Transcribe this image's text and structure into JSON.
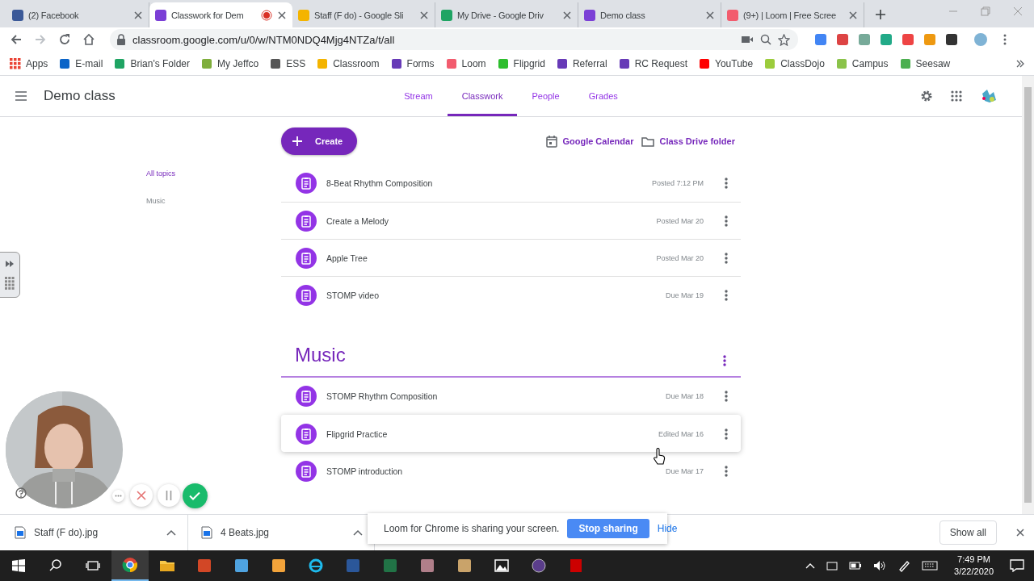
{
  "browser": {
    "tabs": [
      {
        "title": "(2) Facebook",
        "selected": false,
        "recording": false,
        "color": "#3b5998"
      },
      {
        "title": "Classwork for Dem",
        "selected": true,
        "recording": true,
        "color": "#7b3fd6"
      },
      {
        "title": "Staff (F do) - Google Sli",
        "selected": false,
        "recording": false,
        "color": "#f4b400"
      },
      {
        "title": "My Drive - Google Driv",
        "selected": false,
        "recording": false,
        "color": "#1fa463"
      },
      {
        "title": "Demo class",
        "selected": false,
        "recording": false,
        "color": "#7b3fd6"
      },
      {
        "title": "(9+) | Loom | Free Scree",
        "selected": false,
        "recording": false,
        "color": "#f25c6e"
      }
    ],
    "url": "classroom.google.com/u/0/w/NTM0NDQ4Mjg4NTZa/t/all",
    "bookmarks": [
      {
        "label": "Apps",
        "color": "#ea4335"
      },
      {
        "label": "E-mail",
        "color": "#0a64c8"
      },
      {
        "label": "Brian's Folder",
        "color": "#1fa463"
      },
      {
        "label": "My Jeffco",
        "color": "#7fae3c"
      },
      {
        "label": "ESS",
        "color": "#555555"
      },
      {
        "label": "Classroom",
        "color": "#f4b400"
      },
      {
        "label": "Forms",
        "color": "#673ab7"
      },
      {
        "label": "Loom",
        "color": "#f25c6e"
      },
      {
        "label": "Flipgrid",
        "color": "#2dbe2d"
      },
      {
        "label": "Referral",
        "color": "#673ab7"
      },
      {
        "label": "RC Request",
        "color": "#673ab7"
      },
      {
        "label": "YouTube",
        "color": "#ff0000"
      },
      {
        "label": "ClassDojo",
        "color": "#9ccc3c"
      },
      {
        "label": "Campus",
        "color": "#8bc34a"
      },
      {
        "label": "Seesaw",
        "color": "#4caf50"
      }
    ]
  },
  "classroom": {
    "title": "Demo class",
    "nav": [
      {
        "label": "Stream",
        "selected": false
      },
      {
        "label": "Classwork",
        "selected": true
      },
      {
        "label": "People",
        "selected": false
      },
      {
        "label": "Grades",
        "selected": false
      }
    ],
    "create": "Create",
    "links": [
      "Google Calendar",
      "Class Drive folder"
    ],
    "topics": [
      {
        "label": "All topics",
        "selected": true
      },
      {
        "label": "Music",
        "selected": false
      }
    ],
    "items": [
      {
        "title": "8-Beat Rhythm Composition",
        "meta": "Posted 7:12 PM",
        "hovered": false
      },
      {
        "title": "Create a Melody",
        "meta": "Posted Mar 20",
        "hovered": false
      },
      {
        "title": "Apple Tree",
        "meta": "Posted Mar 20",
        "hovered": false
      },
      {
        "title": "STOMP video",
        "meta": "Due Mar 19",
        "hovered": false
      }
    ],
    "sections": [
      {
        "title": "Music",
        "items": [
          {
            "title": "STOMP Rhythm Composition",
            "meta": "Due Mar 18",
            "hovered": false
          },
          {
            "title": "Flipgrid Practice",
            "meta": "Edited Mar 16",
            "hovered": true
          },
          {
            "title": "STOMP introduction",
            "meta": "Due Mar 17",
            "hovered": false
          }
        ]
      }
    ]
  },
  "downloads": {
    "files": [
      "Staff (F do).jpg",
      "4 Beats.jpg"
    ],
    "show_all": "Show all"
  },
  "share_notice": {
    "message": "Loom for Chrome is sharing your screen.",
    "stop": "Stop sharing",
    "hide": "Hide"
  },
  "taskbar": {
    "time": "7:49 PM",
    "date": "3/22/2020"
  }
}
